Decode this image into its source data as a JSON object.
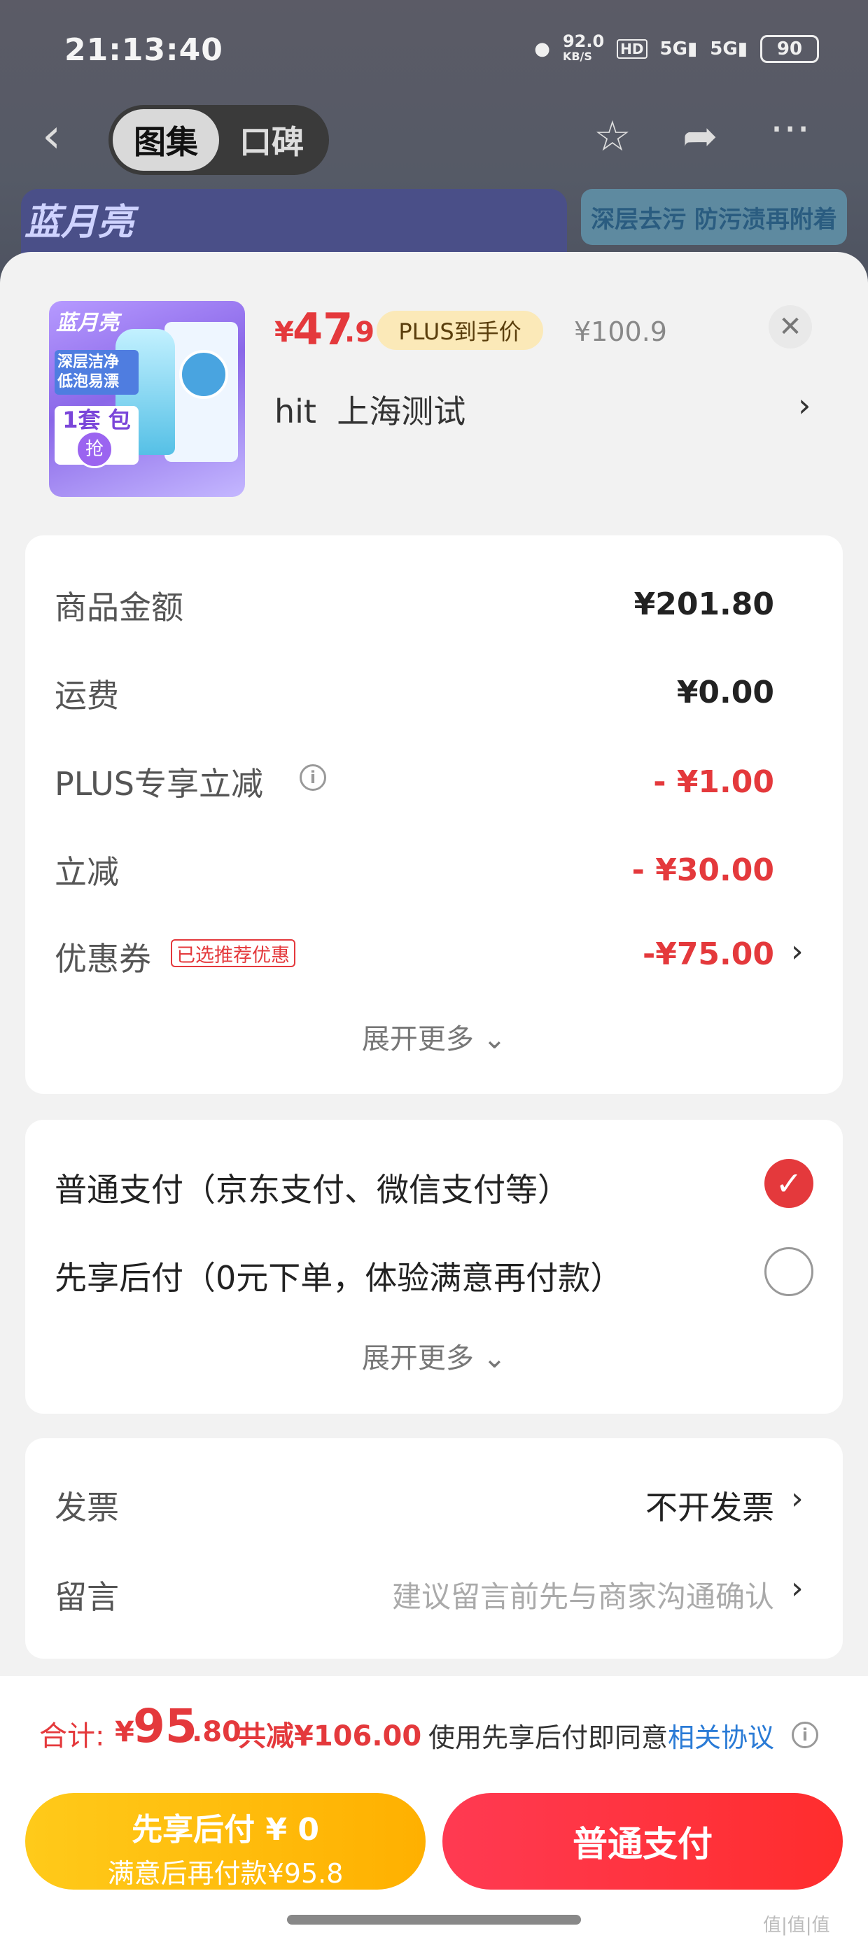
{
  "status_bar": {
    "time": "21:13:40",
    "net_speed": "92.0",
    "net_unit": "KB/S",
    "hd": "HD",
    "signal1": "5G",
    "signal2": "5G",
    "battery": "90"
  },
  "background_page": {
    "tabs": [
      "图集",
      "口碑"
    ],
    "active_tab": "图集",
    "brand": "蓝月亮",
    "promo_tag": "深层去污 防污渍再附着"
  },
  "product": {
    "image_texts": {
      "logo": "蓝月亮",
      "badge": "深层洁净 低泡易漂",
      "tao": "1套 包邮",
      "grab": "抢",
      "seal": "深层洁净"
    },
    "price_currency": "¥",
    "price_int": "47",
    "price_dec": ".9",
    "plus_badge": "PLUS到手价",
    "original_price": "¥100.9",
    "sku": "hit  上海测试"
  },
  "summary": {
    "rows": [
      {
        "label": "商品金额",
        "value": "¥201.80"
      },
      {
        "label": "运费",
        "value": "¥0.00"
      },
      {
        "label": "PLUS专享立减",
        "value": "- ¥1.00"
      },
      {
        "label": "立减",
        "value": "- ¥30.00"
      },
      {
        "label": "优惠券",
        "value": "-¥75.00"
      }
    ],
    "coupon_tag": "已选推荐优惠",
    "expand": "展开更多"
  },
  "payment": {
    "options": [
      {
        "label": "普通支付（京东支付、微信支付等）",
        "selected": true
      },
      {
        "label": "先享后付（0元下单，体验满意再付款）",
        "selected": false
      }
    ],
    "expand": "展开更多"
  },
  "extras": {
    "invoice_label": "发票",
    "invoice_value": "不开发票",
    "message_label": "留言",
    "message_placeholder": "建议留言前先与商家沟通确认"
  },
  "footer": {
    "total_label": "合计:",
    "total_currency": "¥",
    "total_int": "95",
    "total_dec": ".80",
    "total_discount": "共减¥106.00",
    "agree_text": "使用先享后付即同意",
    "agree_link": "相关协议",
    "bnpl_line1": "先享后付 ¥ 0",
    "bnpl_line2": "满意后再付款¥95.8",
    "pay_button": "普通支付"
  },
  "watermark": "值|值|值",
  "colors": {
    "accent_red": "#e4393c",
    "gold": "#ffb000",
    "link_blue": "#2a7bd6"
  }
}
